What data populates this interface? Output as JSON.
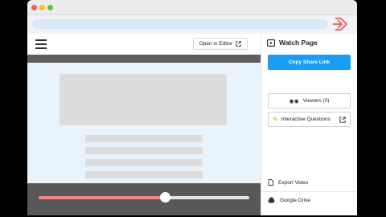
{
  "toolbar": {
    "open_editor_label": "Open in Editor"
  },
  "side_panel": {
    "title": "Watch Page",
    "share_label": "Copy Share Link",
    "viewers_label": "Viewers (0)",
    "questions_label": "Interactive Questions",
    "export_label": "Export Video",
    "drive_label": "Google Drive"
  },
  "player": {
    "progress": 0.6
  },
  "colors": {
    "accent": "#189ef5",
    "scrub_fill": "#ee8383",
    "address_bar": "#d9e9f8",
    "content_bg": "#e9f3fb"
  },
  "icons": [
    "hamburger-icon",
    "external-link-icon",
    "watch-page-icon",
    "eyes-icon",
    "pencil-icon",
    "export-icon",
    "google-drive-icon",
    "extension-icon"
  ]
}
